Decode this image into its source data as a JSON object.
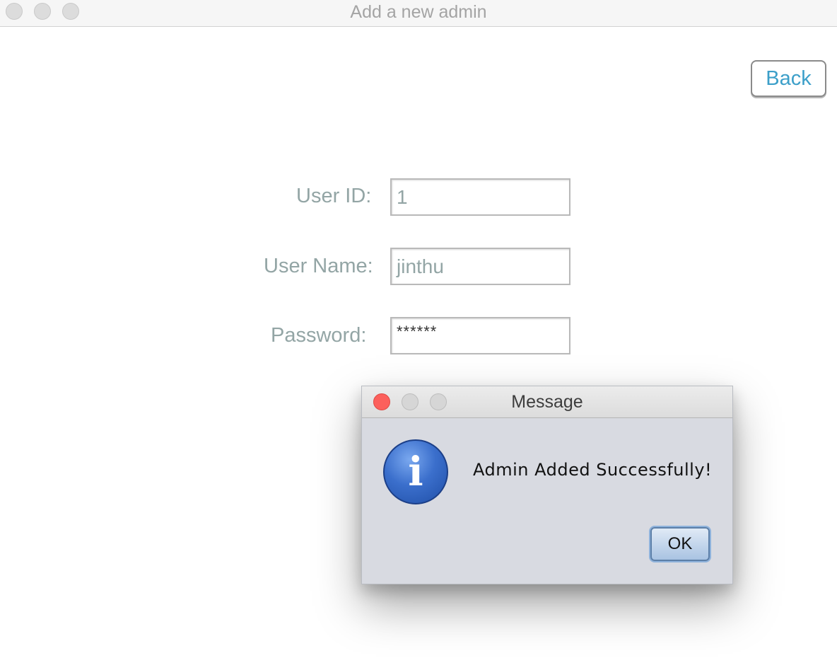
{
  "window": {
    "title": "Add a new admin"
  },
  "header": {
    "back_label": "Back"
  },
  "form": {
    "user_id_label": "User ID:",
    "user_id_value": "1",
    "user_name_label": "User Name:",
    "user_name_value": "jinthu",
    "password_label": "Password:",
    "password_value": "******"
  },
  "dialog": {
    "title": "Message",
    "message": "Admin Added Successfully!",
    "ok_label": "OK",
    "icon": "info-icon",
    "icon_glyph": "i"
  },
  "colors": {
    "accent": "#3c9fc9",
    "label": "#93a5a5",
    "close_red": "#fc605c"
  }
}
